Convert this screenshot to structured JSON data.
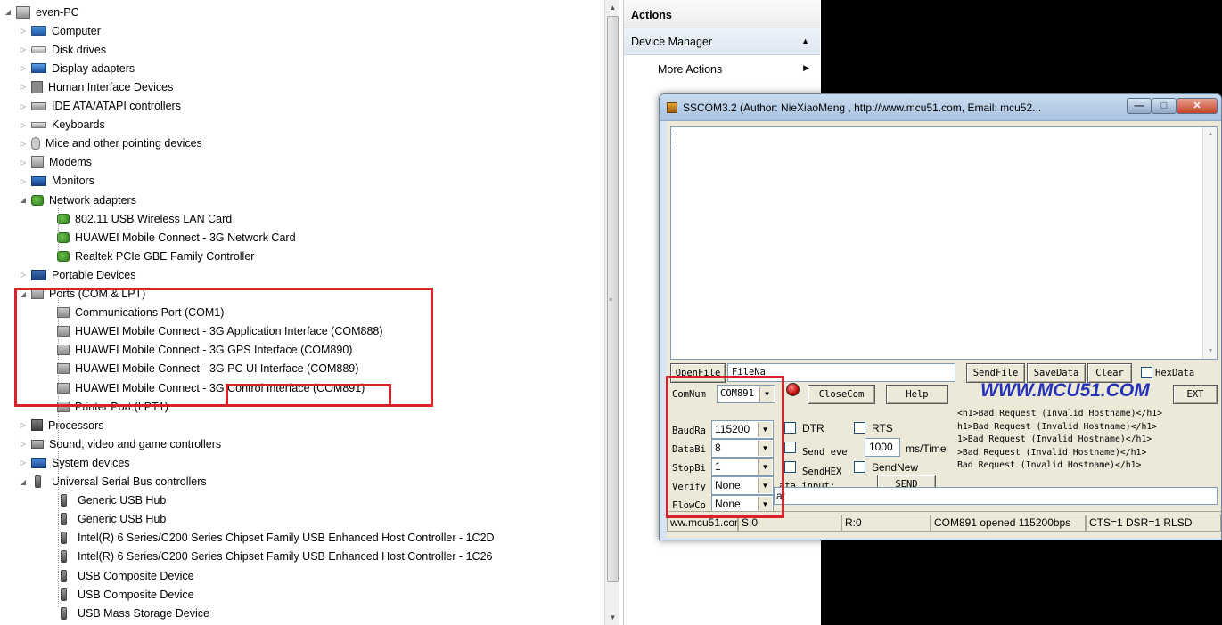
{
  "device_manager": {
    "tree": [
      {
        "label": "even-PC",
        "expander": "◢",
        "icon": "computer-root-icon"
      },
      {
        "label": "Computer",
        "expander": "▷",
        "icon": "computer-icon"
      },
      {
        "label": "Disk drives",
        "expander": "▷",
        "icon": "disk-drive-icon"
      },
      {
        "label": "Display adapters",
        "expander": "▷",
        "icon": "display-adapter-icon"
      },
      {
        "label": "Human Interface Devices",
        "expander": "▷",
        "icon": "hid-icon"
      },
      {
        "label": "IDE ATA/ATAPI controllers",
        "expander": "▷",
        "icon": "ide-controller-icon"
      },
      {
        "label": "Keyboards",
        "expander": "▷",
        "icon": "keyboard-icon"
      },
      {
        "label": "Mice and other pointing devices",
        "expander": "▷",
        "icon": "mouse-icon"
      },
      {
        "label": "Modems",
        "expander": "▷",
        "icon": "modem-icon"
      },
      {
        "label": "Monitors",
        "expander": "▷",
        "icon": "monitor-icon"
      },
      {
        "label": "Network adapters",
        "expander": "◢",
        "icon": "network-adapter-icon"
      },
      {
        "label": "802.11 USB Wireless LAN Card",
        "expander": "",
        "icon": "network-adapter-icon"
      },
      {
        "label": "HUAWEI Mobile Connect - 3G Network Card",
        "expander": "",
        "icon": "network-adapter-icon"
      },
      {
        "label": "Realtek PCIe GBE Family Controller",
        "expander": "",
        "icon": "network-adapter-icon"
      },
      {
        "label": "Portable Devices",
        "expander": "▷",
        "icon": "portable-device-icon"
      },
      {
        "label": "Ports (COM & LPT)",
        "expander": "◢",
        "icon": "port-icon"
      },
      {
        "label": "Communications Port (COM1)",
        "expander": "",
        "icon": "port-icon"
      },
      {
        "label": "HUAWEI Mobile Connect - 3G Application Interface (COM888)",
        "expander": "",
        "icon": "port-icon"
      },
      {
        "label": "HUAWEI Mobile Connect - 3G GPS Interface (COM890)",
        "expander": "",
        "icon": "port-icon"
      },
      {
        "label": "HUAWEI Mobile Connect - 3G PC UI Interface (COM889)",
        "expander": "",
        "icon": "port-icon"
      },
      {
        "label": "HUAWEI Mobile Connect - 3G Control Interface (COM891)",
        "expander": "",
        "icon": "port-icon"
      },
      {
        "label": "Printer Port (LPT1)",
        "expander": "",
        "icon": "port-icon"
      },
      {
        "label": "Processors",
        "expander": "▷",
        "icon": "processor-icon"
      },
      {
        "label": "Sound, video and game controllers",
        "expander": "▷",
        "icon": "sound-icon"
      },
      {
        "label": "System devices",
        "expander": "▷",
        "icon": "system-device-icon"
      },
      {
        "label": "Universal Serial Bus controllers",
        "expander": "◢",
        "icon": "usb-icon"
      },
      {
        "label": "Generic USB Hub",
        "expander": "",
        "icon": "usb-icon"
      },
      {
        "label": "Generic USB Hub",
        "expander": "",
        "icon": "usb-icon"
      },
      {
        "label": "Intel(R) 6 Series/C200 Series Chipset Family USB Enhanced Host Controller - 1C2D",
        "expander": "",
        "icon": "usb-icon"
      },
      {
        "label": "Intel(R) 6 Series/C200 Series Chipset Family USB Enhanced Host Controller - 1C26",
        "expander": "",
        "icon": "usb-icon"
      },
      {
        "label": "USB Composite Device",
        "expander": "",
        "icon": "usb-icon"
      },
      {
        "label": "USB Composite Device",
        "expander": "",
        "icon": "usb-icon"
      },
      {
        "label": "USB Mass Storage Device",
        "expander": "",
        "icon": "usb-icon"
      }
    ],
    "com891_highlight": "Control Interface (COM891)"
  },
  "actions": {
    "header": "Actions",
    "group": "Device Manager",
    "more": "More Actions"
  },
  "sscom": {
    "title": "SSCOM3.2 (Author: NieXiaoMeng , http://www.mcu51.com, Email: mcu52...",
    "window_buttons": {
      "minimize": "—",
      "maximize": "□",
      "close": "✕"
    },
    "open_file_label": "OpenFile",
    "file_name_value": "FileNa",
    "send_file_label": "SendFile",
    "save_data_label": "SaveData",
    "clear_label": "Clear",
    "hex_data_label": "HexData",
    "com_num_label": "ComNum",
    "com_num_value": "COM891",
    "close_com_label": "CloseCom",
    "help_label": "Help",
    "website_label": "WWW.MCU51.COM",
    "ext_label": "EXT",
    "baud_label": "BaudRa",
    "baud_value": "115200",
    "databits_label": "DataBi",
    "databits_value": "8",
    "stopbits_label": "StopBi",
    "stopbits_value": "1",
    "verify_label": "Verify",
    "verify_value": "None",
    "flow_label": "FlowCo",
    "flow_value": "None",
    "dtr_label": "DTR",
    "rts_label": "RTS",
    "send_every_label": "Send eve",
    "send_every_value": "1000",
    "ms_time_label": "ms/Time",
    "send_hex_label": "SendHEX",
    "send_new_label": "SendNew",
    "data_input_label": "ata input:",
    "send_label": "SEND",
    "send_input_value": "at",
    "http_lines": [
      "<h1>Bad Request (Invalid Hostname)</h1>",
      "h1>Bad Request (Invalid Hostname)</h1>",
      "1>Bad Request (Invalid Hostname)</h1>",
      ">Bad Request (Invalid Hostname)</h1>",
      "Bad Request (Invalid Hostname)</h1>"
    ],
    "status": {
      "site": "ww.mcu51.con",
      "sent": "S:0",
      "received": "R:0",
      "port_state": "COM891 opened 115200bps",
      "lines": "CTS=1 DSR=1 RLSD"
    }
  },
  "colors": {
    "highlight_red": "#d9232b",
    "website_blue": "#2431b8",
    "led_red": "#c81010"
  }
}
